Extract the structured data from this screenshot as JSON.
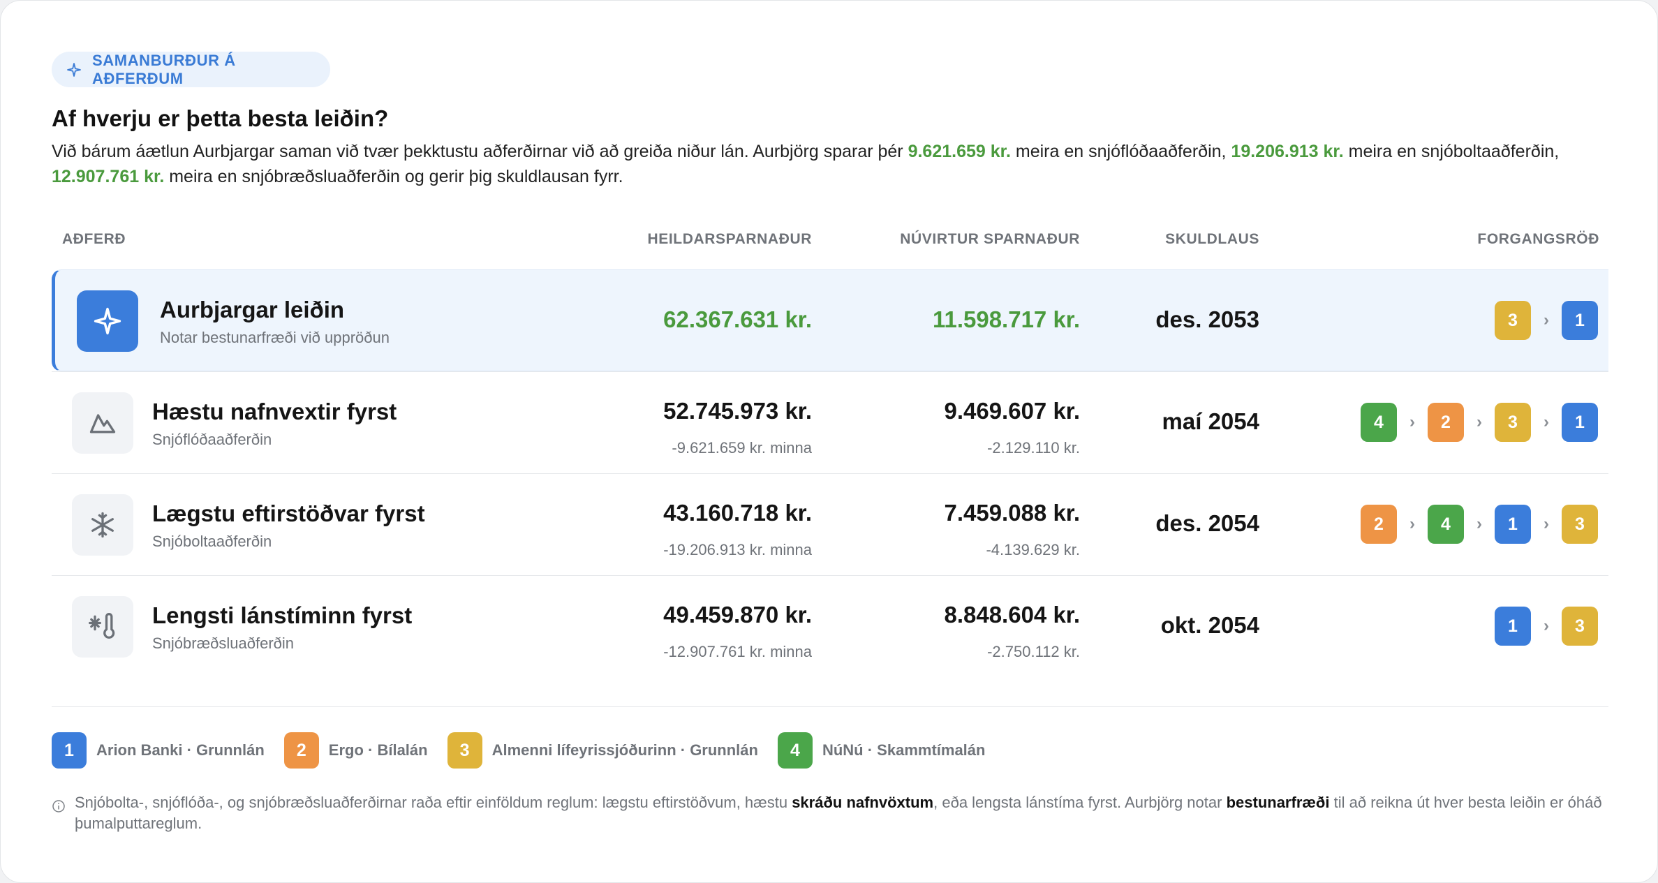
{
  "badge": {
    "label": "SAMANBURÐUR Á AÐFERÐUM",
    "icon": "sparkle-icon"
  },
  "title": "Af hverju er þetta besta leiðin?",
  "intro": {
    "t1": "Við bárum áætlun Aurbjargar saman við tvær þekktustu aðferðirnar við að greiða niður lán. Aurbjörg sparar þér ",
    "v1": "9.621.659 kr.",
    "t2": " meira en snjóflóðaaðferðin, ",
    "v2": "19.206.913 kr.",
    "t3": " meira en snjóboltaaðferðin, ",
    "v3": "12.907.761 kr.",
    "t4": " meira en snjóbræðsluaðferðin og gerir þig skuldlausan fyrr."
  },
  "columns": {
    "method": "AÐFERÐ",
    "total": "HEILDARSPARNAÐUR",
    "pv": "NÚVIRTUR SPARNAÐUR",
    "debtfree": "SKULDLAUS",
    "order": "FORGANGSRÖÐ"
  },
  "rows": [
    {
      "name": "Aurbjargar leiðin",
      "sub": "Notar bestunarfræði við uppröðun",
      "icon": "sparkle-icon",
      "total": "62.367.631 kr.",
      "pv": "11.598.717 kr.",
      "debtfree": "des. 2053",
      "order": [
        "3",
        "1"
      ]
    },
    {
      "name": "Hæstu nafnvextir fyrst",
      "sub": "Snjóflóðaaðferðin",
      "icon": "mountain-icon",
      "total": "52.745.973 kr.",
      "total_diff": "-9.621.659 kr. minna",
      "pv": "9.469.607 kr.",
      "pv_diff": "-2.129.110 kr.",
      "debtfree": "maí 2054",
      "order": [
        "4",
        "2",
        "3",
        "1"
      ]
    },
    {
      "name": "Lægstu eftirstöðvar fyrst",
      "sub": "Snjóboltaaðferðin",
      "icon": "snowflake-icon",
      "total": "43.160.718 kr.",
      "total_diff": "-19.206.913 kr. minna",
      "pv": "7.459.088 kr.",
      "pv_diff": "-4.139.629 kr.",
      "debtfree": "des. 2054",
      "order": [
        "2",
        "4",
        "1",
        "3"
      ]
    },
    {
      "name": "Lengsti lánstíminn fyrst",
      "sub": "Snjóbræðsluaðferðin",
      "icon": "thermometer-snow-icon",
      "total": "49.459.870 kr.",
      "total_diff": "-12.907.761 kr. minna",
      "pv": "8.848.604 kr.",
      "pv_diff": "-2.750.112 kr.",
      "debtfree": "okt. 2054",
      "order": [
        "1",
        "3"
      ]
    }
  ],
  "legend": [
    {
      "num": "1",
      "label": "Arion Banki · Grunnlán",
      "color": "#3b7ddb"
    },
    {
      "num": "2",
      "label": "Ergo · Bílalán",
      "color": "#ee9445"
    },
    {
      "num": "3",
      "label": "Almenni lífeyrissjóðurinn · Grunnlán",
      "color": "#dfb43a"
    },
    {
      "num": "4",
      "label": "NúNú · Skammtímalán",
      "color": "#4ba64a"
    }
  ],
  "note": {
    "icon": "info-icon",
    "t1": "Snjóbolta-, snjóflóða-, og snjóbræðsluaðferðirnar raða eftir einföldum reglum: lægstu eftirstöðvum, hæstu ",
    "b1": "skráðu nafnvöxtum",
    "t2": ", eða lengsta lánstíma fyrst. Aurbjörg notar ",
    "b2": "bestunarfræði",
    "t3": " til að reikna út hver besta leiðin er óháð þumalputtareglum."
  },
  "colors": {
    "accent": "#3b7ddb",
    "positive": "#4a9a3d"
  }
}
